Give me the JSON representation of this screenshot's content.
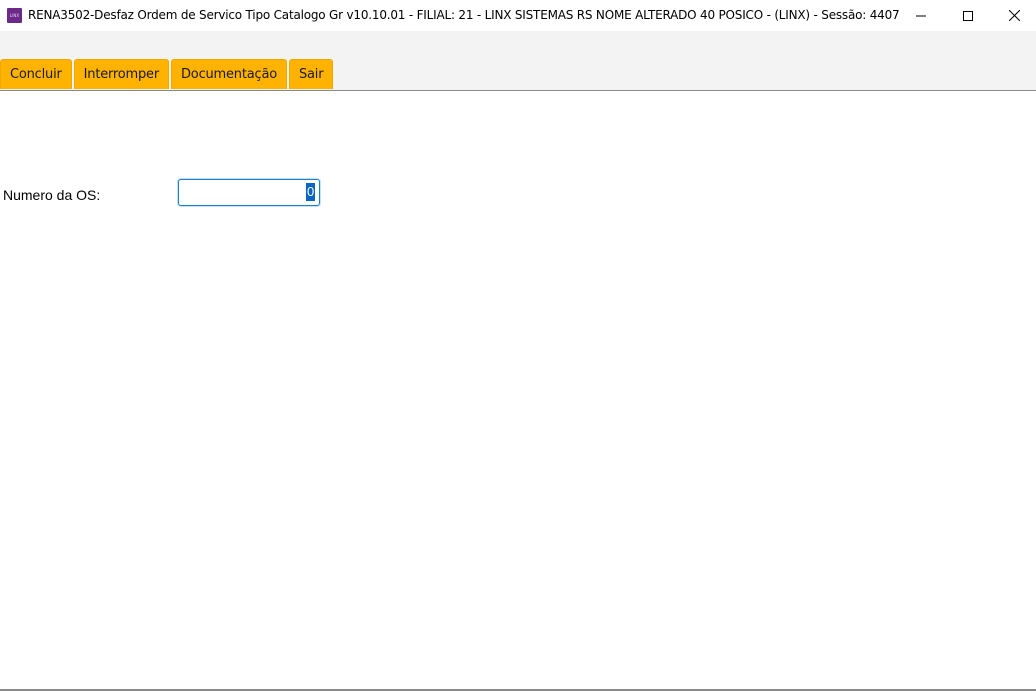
{
  "window": {
    "title": "RENA3502-Desfaz Ordem de Servico Tipo Catalogo Gr v10.10.01   - FILIAL: 21 - LINX SISTEMAS RS NOME ALTERADO 40 POSICO - (LINX) - Sessão: 4407",
    "icon": "linx-app-icon",
    "icon_text": "LINX",
    "icon_color": "#6b2a8a",
    "controls": [
      "minimize-icon",
      "maximize-icon",
      "close-icon"
    ]
  },
  "toolbar": {
    "tabs": [
      {
        "label": "Concluir"
      },
      {
        "label": "Interromper"
      },
      {
        "label": "Documentação"
      },
      {
        "label": "Sair"
      }
    ],
    "tab_color": "#ffb300"
  },
  "form": {
    "os_number": {
      "label": "Numero da OS:",
      "value": "0",
      "focus_color": "#1e7fcb"
    }
  }
}
